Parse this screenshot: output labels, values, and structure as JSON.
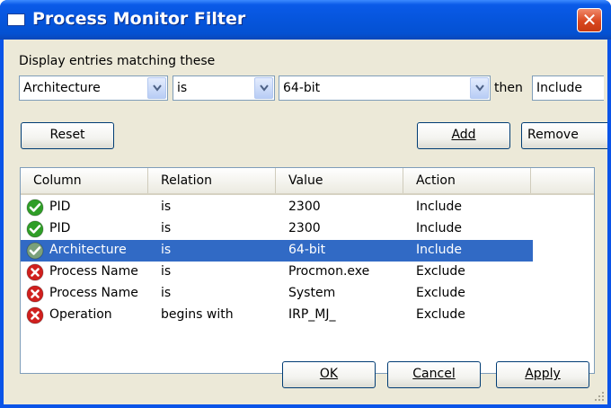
{
  "window": {
    "title": "Process Monitor Filter",
    "close_glyph": "✕"
  },
  "filter": {
    "label": "Display entries matching these",
    "column_value": "Architecture",
    "relation_value": "is",
    "value_value": "64-bit",
    "then_label": "then",
    "action_value": "Include"
  },
  "buttons": {
    "reset": "Reset",
    "add": "Add",
    "remove": "Remove",
    "ok": "OK",
    "cancel": "Cancel",
    "apply": "Apply"
  },
  "table": {
    "headers": [
      "Column",
      "Relation",
      "Value",
      "Action"
    ],
    "rows": [
      {
        "icon": "check-icon",
        "column": "PID",
        "relation": "is",
        "value": "2300",
        "action": "Include"
      },
      {
        "icon": "check-icon",
        "column": "PID",
        "relation": "is",
        "value": "2300",
        "action": "Include"
      },
      {
        "icon": "check-icon",
        "column": "Architecture",
        "relation": "is",
        "value": "64-bit",
        "action": "Include",
        "selected": true
      },
      {
        "icon": "x-icon",
        "column": "Process Name",
        "relation": "is",
        "value": "Procmon.exe",
        "action": "Exclude"
      },
      {
        "icon": "x-icon",
        "column": "Process Name",
        "relation": "is",
        "value": "System",
        "action": "Exclude"
      },
      {
        "icon": "x-icon",
        "column": "Operation",
        "relation": "begins with",
        "value": "IRP_MJ_",
        "action": "Exclude"
      }
    ]
  },
  "colors": {
    "include": "#2f9e27",
    "exclude": "#d0201e",
    "selection": "#316ac5"
  }
}
